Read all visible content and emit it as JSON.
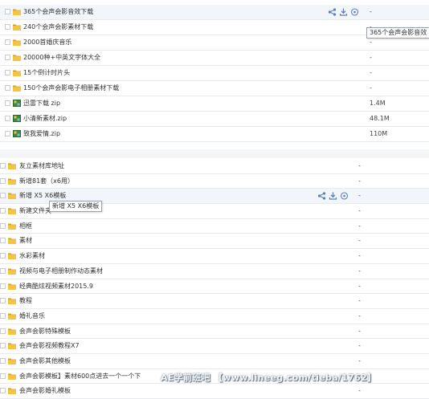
{
  "colors": {
    "folder": "#f4c542",
    "folder_dark": "#d8a11e",
    "zip": "#3a8a3f",
    "action": "#5b7fb6",
    "row_border": "#e8eaee"
  },
  "panel_top": {
    "rows": [
      {
        "type": "folder",
        "name": "365个会声会影音效下载",
        "size": "-",
        "hover": true
      },
      {
        "type": "folder",
        "name": "240个会声会影素材下载",
        "size": "-"
      },
      {
        "type": "folder",
        "name": "2000首婚庆音乐",
        "size": "-"
      },
      {
        "type": "folder",
        "name": "20000种+中英文字体大全",
        "size": "-"
      },
      {
        "type": "folder",
        "name": "15个倒计时片头",
        "size": "-"
      },
      {
        "type": "folder",
        "name": "150个会声会影电子相册素材下载",
        "size": "-"
      },
      {
        "type": "zip",
        "name": "迅雷下载 zip",
        "size": "1.4M"
      },
      {
        "type": "zip",
        "name": "小清新素材.zip",
        "size": "48.1M"
      },
      {
        "type": "zip",
        "name": "致我爱情.zip",
        "size": "110M"
      }
    ],
    "tooltip": "365个会声会影音效",
    "actions": [
      "share-icon",
      "download-icon",
      "more-icon"
    ]
  },
  "panel_bottom": {
    "rows": [
      {
        "type": "folder",
        "name": "友立素材库地址",
        "size": "-"
      },
      {
        "type": "folder",
        "name": "新增81套（x6用）",
        "size": "-"
      },
      {
        "type": "folder",
        "name": "新增 X5 X6模板",
        "size": "-",
        "hover": true
      },
      {
        "type": "folder",
        "name": "新建文件夹",
        "size": "-"
      },
      {
        "type": "folder",
        "name": "相框",
        "size": "-"
      },
      {
        "type": "folder",
        "name": "素材",
        "size": "-"
      },
      {
        "type": "folder",
        "name": "水彩素材",
        "size": "-"
      },
      {
        "type": "folder",
        "name": "视频与电子相册制作动态素材",
        "size": "-"
      },
      {
        "type": "folder",
        "name": "经典酷炫视频素材2015.9",
        "size": "-"
      },
      {
        "type": "folder",
        "name": "教程",
        "size": "-"
      },
      {
        "type": "folder",
        "name": "婚礼音乐",
        "size": "-"
      },
      {
        "type": "folder",
        "name": "会声会影特殊模板",
        "size": "-"
      },
      {
        "type": "folder",
        "name": "会声会影视频教程X7",
        "size": "-"
      },
      {
        "type": "folder",
        "name": "会声会影其他模板",
        "size": "-"
      },
      {
        "type": "folder",
        "name": "会声会影模板】素材600点进去一个一个下",
        "size": "-"
      },
      {
        "type": "folder",
        "name": "会声会影婚礼模板",
        "size": "-"
      }
    ],
    "tooltip": "新增 X5 X6模板",
    "actions": [
      "share-icon",
      "download-icon",
      "more-icon"
    ]
  },
  "watermark": "AE学前班吧 【www.lineeg.com/tieba/1762】"
}
